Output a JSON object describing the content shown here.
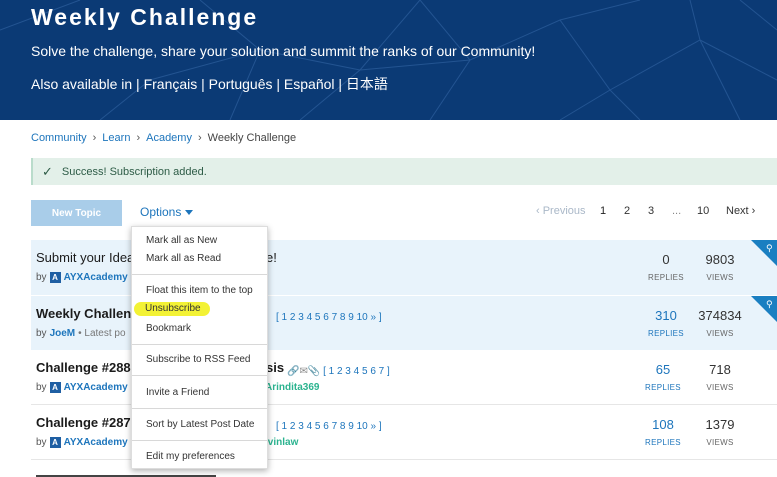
{
  "hero": {
    "title": "Weekly Challenge",
    "subtitle": "Solve the challenge, share your solution and summit the ranks of our Community!",
    "languages": "Also available in | Français | Português | Español | 日本語"
  },
  "breadcrumb": {
    "items": [
      "Community",
      "Learn",
      "Academy"
    ],
    "current": "Weekly Challenge"
  },
  "alert": {
    "message": "Success! Subscription added."
  },
  "toolbar": {
    "new_topic": "New Topic",
    "options": "Options"
  },
  "pager": {
    "previous": "‹ Previous",
    "pages": [
      "1",
      "2",
      "3",
      "...",
      "10"
    ],
    "next": "Next ›",
    "current": "1"
  },
  "topics": [
    {
      "title": "Submit your Idea",
      "title_tail": "e!",
      "by_prefix": "by",
      "author": "AYXAcademy",
      "replies": "0",
      "replies_label": "REPLIES",
      "views": "9803",
      "views_label": "VIEWS"
    },
    {
      "title": "Weekly Challen",
      "by_prefix": "by",
      "author": "JoeM",
      "latest": "• Latest po",
      "pages": "[ 1 2 3 4 5 6 7 8 9 10 » ]",
      "replies": "310",
      "replies_label": "REPLIES",
      "views": "374834",
      "views_label": "VIEWS"
    },
    {
      "title": "Challenge #288",
      "title_tail": "sis",
      "by_prefix": "by",
      "author": "AYXAcademy",
      "last_user": "Arindita369",
      "pages": "[ 1 2 3 4 5 6 7 ]",
      "replies": "65",
      "replies_label": "REPLIES",
      "views": "718",
      "views_label": "VIEWS"
    },
    {
      "title": "Challenge #287",
      "by_prefix": "by",
      "author": "AYXAcademy",
      "last_user": "lvinlaw",
      "pages": "[ 1 2 3 4 5 6 7 8 9 10 » ]",
      "replies": "108",
      "replies_label": "REPLIES",
      "views": "1379",
      "views_label": "VIEWS"
    }
  ],
  "menu": {
    "items": [
      "Mark all as New",
      "Mark all as Read",
      "Float this item to the top",
      "Unsubscribe",
      "Bookmark",
      "Subscribe to RSS Feed",
      "Invite a Friend",
      "Sort by Latest Post Date",
      "Edit my preferences"
    ]
  },
  "colors": {
    "hero_bg": "#0b3a75",
    "link": "#1d75bc",
    "highlight": "#f2f12a",
    "pin": "#1a7fc1"
  },
  "icons": [
    "check-icon",
    "chevron-right-icon",
    "caret-down-icon",
    "pin-icon",
    "alteryx-logo-icon"
  ]
}
